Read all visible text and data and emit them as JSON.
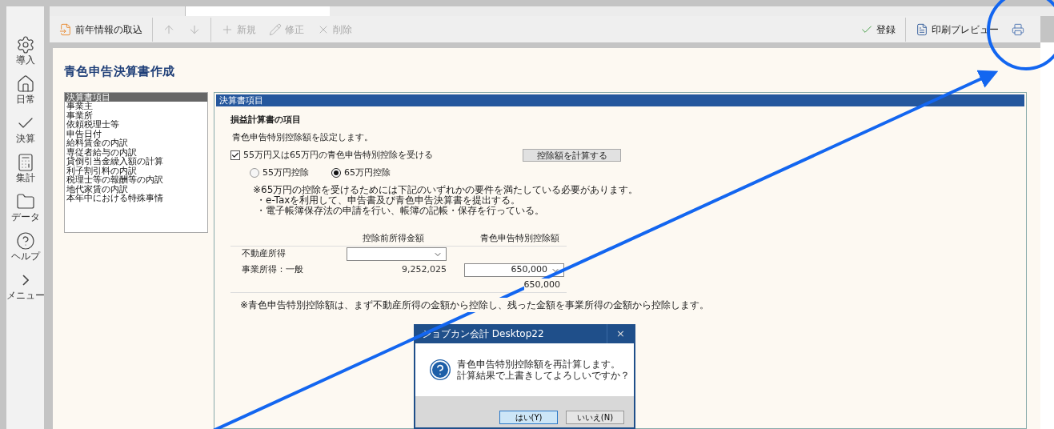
{
  "sidebar": [
    {
      "label": "導入",
      "kind": "setup"
    },
    {
      "label": "日常",
      "kind": "daily"
    },
    {
      "label": "決算",
      "kind": "closing"
    },
    {
      "label": "集計",
      "kind": "summary"
    },
    {
      "label": "データ",
      "kind": "data"
    },
    {
      "label": "ヘルプ",
      "kind": "help"
    },
    {
      "label": "メニュー",
      "kind": "menu"
    }
  ],
  "toolbar": {
    "left": [
      {
        "kind": "import",
        "label": "前年情報の取込",
        "disabled": false
      },
      {
        "kind": "up",
        "disabled": true
      },
      {
        "kind": "down",
        "disabled": true
      },
      {
        "kind": "new",
        "label": "新規",
        "disabled": true
      },
      {
        "kind": "edit",
        "label": "修正",
        "disabled": true
      },
      {
        "kind": "delete",
        "label": "削除",
        "disabled": true
      }
    ],
    "right": [
      {
        "kind": "save",
        "label": "登録",
        "disabled": false
      },
      {
        "kind": "preview",
        "label": "印刷プレビュー",
        "disabled": false
      },
      {
        "kind": "print",
        "disabled": false
      }
    ]
  },
  "title": "青色申告決算書作成",
  "nav_list": [
    {
      "label": "決算書項目",
      "selected": true
    },
    {
      "label": "事業主",
      "selected": false
    },
    {
      "label": "事業所",
      "selected": false
    },
    {
      "label": "依頼税理士等",
      "selected": false
    },
    {
      "label": "申告日付",
      "selected": false
    },
    {
      "label": "給料賃金の内訳",
      "selected": false
    },
    {
      "label": "専従者給与の内訳",
      "selected": false
    },
    {
      "label": "貸倒引当金繰入額の計算",
      "selected": false
    },
    {
      "label": "利子割引料の内訳",
      "selected": false
    },
    {
      "label": "税理士等の報酬等の内訳",
      "selected": false
    },
    {
      "label": "地代家賃の内訳",
      "selected": false
    },
    {
      "label": "本年中における特殊事情",
      "selected": false
    }
  ],
  "panel": {
    "header": "決算書項目",
    "section": "損益計算書の項目",
    "intro": "青色申告特別控除額を設定します。",
    "checkbox": {
      "label": "55万円又は65万円の青色申告特別控除を受ける",
      "checked": true
    },
    "calc_button": "控除額を計算する",
    "radios": [
      {
        "label": "55万円控除",
        "selected": false
      },
      {
        "label": "65万円控除",
        "selected": true
      }
    ],
    "notes": [
      "※65万円の控除を受けるためには下記のいずれかの要件を満たしている必要があります。",
      "・e-Taxを利用して、申告書及び青色申告決算書を提出する。",
      "・電子帳簿保存法の申請を行い、帳簿の記帳・保存を行っている。"
    ],
    "table": {
      "columns": [
        "控除前所得金額",
        "青色申告特別控除額"
      ],
      "rows": [
        {
          "label": "不動産所得",
          "cells": [
            {
              "kind": "select"
            },
            {
              "kind": "empty"
            }
          ]
        },
        {
          "label": "事業所得：一般",
          "cells": [
            {
              "kind": "text",
              "value": "9,252,025"
            },
            {
              "kind": "select",
              "value": "650,000"
            }
          ]
        }
      ],
      "total": "650,000"
    },
    "footnote": "※青色申告特別控除額は、まず不動産所得の金額から控除し、残った金額を事業所得の金額から控除します。"
  },
  "dialog": {
    "title": "ジョブカン会計 Desktop22",
    "close": "×",
    "message": [
      "青色申告特別控除額を再計算します。",
      "計算結果で上書きしてよろしいですか？"
    ],
    "buttons": [
      {
        "label": "はい(Y)",
        "selected": true
      },
      {
        "label": "いいえ(N)",
        "selected": false
      }
    ]
  }
}
